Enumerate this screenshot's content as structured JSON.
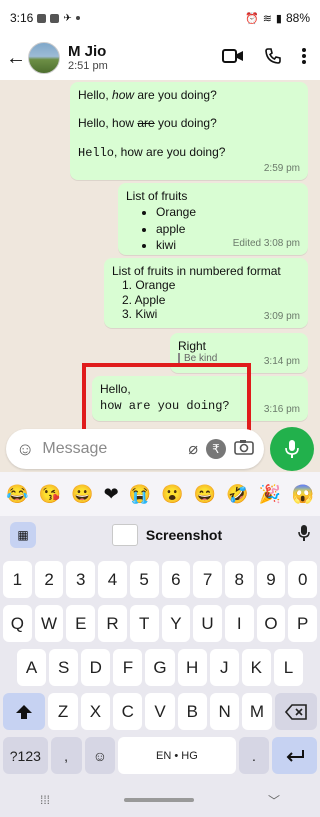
{
  "status": {
    "time": "3:16",
    "battery": "88%"
  },
  "header": {
    "name": "M Jio",
    "subtitle": "2:51 pm"
  },
  "messages": [
    {
      "lines": [
        "Hello, how are you doing?",
        "Hello, how are you doing?",
        "Hello, how are you doing?"
      ],
      "time": "2:59 pm"
    },
    {
      "title": "List of fruits",
      "items": [
        "Orange",
        "apple",
        "kiwi"
      ],
      "time": "Edited 3:08 pm"
    },
    {
      "title": "List of fruits in numbered format",
      "items": [
        "1. Orange",
        "2. Apple",
        "3. Kiwi"
      ],
      "time": "3:09 pm"
    },
    {
      "text": "Right",
      "quote": "Be kind",
      "time": "3:14 pm"
    },
    {
      "line1": "Hello,",
      "line2": "how are you doing?",
      "time": "3:16 pm"
    }
  ],
  "composer": {
    "placeholder": "Message"
  },
  "keyboard": {
    "suggestion": "Screenshot",
    "row1": [
      "1",
      "2",
      "3",
      "4",
      "5",
      "6",
      "7",
      "8",
      "9",
      "0"
    ],
    "row2": [
      "Q",
      "W",
      "E",
      "R",
      "T",
      "Y",
      "U",
      "I",
      "O",
      "P"
    ],
    "row3": [
      "A",
      "S",
      "D",
      "F",
      "G",
      "H",
      "J",
      "K",
      "L"
    ],
    "row4": [
      "Z",
      "X",
      "C",
      "V",
      "B",
      "N",
      "M"
    ],
    "sym": "?123",
    "comma": ",",
    "space": "EN • HG",
    "period": "."
  }
}
